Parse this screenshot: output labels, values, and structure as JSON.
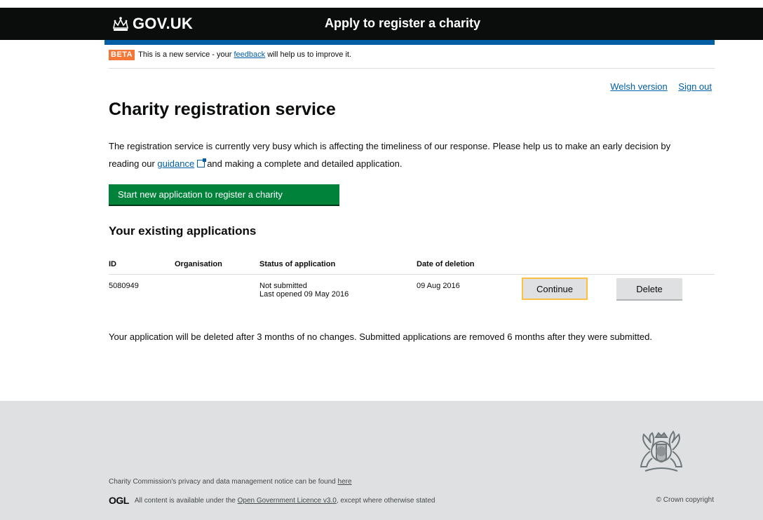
{
  "header": {
    "logo_text": "GOV.UK",
    "service_name": "Apply to register a charity"
  },
  "beta": {
    "tag": "BETA",
    "text_before": "This is a new service - your",
    "link": "feedback",
    "text_after": "will help us to improve it."
  },
  "toplinks": {
    "welsh": "Welsh version",
    "signout": "Sign out"
  },
  "main": {
    "title": "Charity registration service",
    "intro_before": "The registration service is currently very busy which is affecting the timeliness of our response. Please help us to make an early decision by reading our",
    "intro_link": "guidance",
    "intro_after": "and making a complete and detailed application.",
    "start_button": "Start new application to register a charity",
    "existing_heading": "Your existing applications",
    "retention_text": "Your application will be deleted after 3 months of no changes. Submitted applications are removed 6 months after they were submitted."
  },
  "table": {
    "headers": [
      "ID",
      "Organisation",
      "Status of application",
      "Date of deletion"
    ],
    "rows": [
      {
        "id": "5080949",
        "organisation": "",
        "status": "Not submitted",
        "last_opened": "Last opened 09 May 2016",
        "deletion_date": "09 Aug 2016",
        "continue_label": "Continue",
        "delete_label": "Delete"
      }
    ]
  },
  "footer": {
    "privacy_text": "Charity Commission's privacy and data management notice can be found",
    "privacy_link": "here",
    "ogl": "OGL",
    "licence_before": "All content is available under the",
    "licence_link": "Open Government Licence v3.0",
    "licence_after": ", except where otherwise stated",
    "copyright": "© Crown copyright"
  },
  "colors": {
    "header_bg": "#0b0c0c",
    "blue_line": "#005ea5",
    "beta_tag": "#f47738",
    "start_button": "#00823b",
    "focus_border": "#ffbf47",
    "footer_bg": "#dee0e2",
    "link": "#005ea5"
  }
}
